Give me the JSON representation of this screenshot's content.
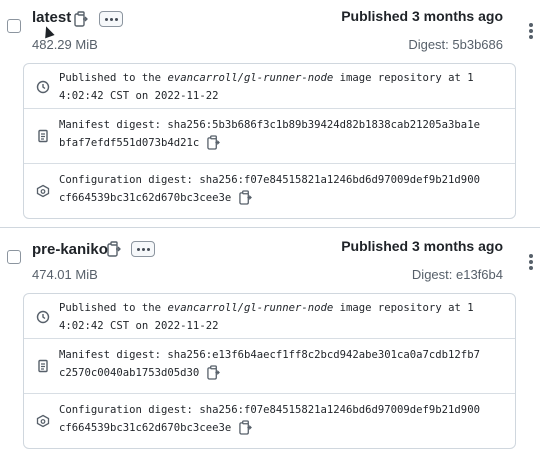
{
  "tags": [
    {
      "name": "latest",
      "size": "482.29 MiB",
      "published": "Published 3 months ago",
      "digest_short": "Digest: 5b3b686",
      "published_line1_pre": "Published to the ",
      "published_repo": "evancarroll/gl-runner-node",
      "published_line1_post": " image repository at 1",
      "published_line2": "4:02:42 CST on 2022-11-22",
      "manifest_line1": "Manifest digest: sha256:5b3b686f3c1b89b39424d82b1838cab21205a3ba1e",
      "manifest_line2": "bfaf7efdf551d073b4d21c",
      "config_line1": "Configuration digest: sha256:f07e84515821a1246bd6d97009def9b21d900",
      "config_line2": "cf664539bc31c62d670bc3cee3e"
    },
    {
      "name": "pre-kaniko",
      "size": "474.01 MiB",
      "published": "Published 3 months ago",
      "digest_short": "Digest: e13f6b4",
      "published_line1_pre": "Published to the ",
      "published_repo": "evancarroll/gl-runner-node",
      "published_line1_post": " image repository at 1",
      "published_line2": "4:02:42 CST on 2022-11-22",
      "manifest_line1": "Manifest digest: sha256:e13f6b4aecf1ff8c2bcd942abe301ca0a7cdb12fb7",
      "manifest_line2": "c2570c0040ab1753d05d30",
      "config_line1": "Configuration digest: sha256:f07e84515821a1246bd6d97009def9b21d900",
      "config_line2": "cf664539bc31c62d670bc3cee3e"
    }
  ],
  "icons": {
    "copy": "copy-icon",
    "more": "ellipsis-icon",
    "kebab": "kebab-menu-icon",
    "clock": "clock-icon",
    "file": "file-icon",
    "config": "package-icon"
  },
  "colors": {
    "text": "#1f2328",
    "muted": "#57606a",
    "border": "#d0d7de"
  }
}
